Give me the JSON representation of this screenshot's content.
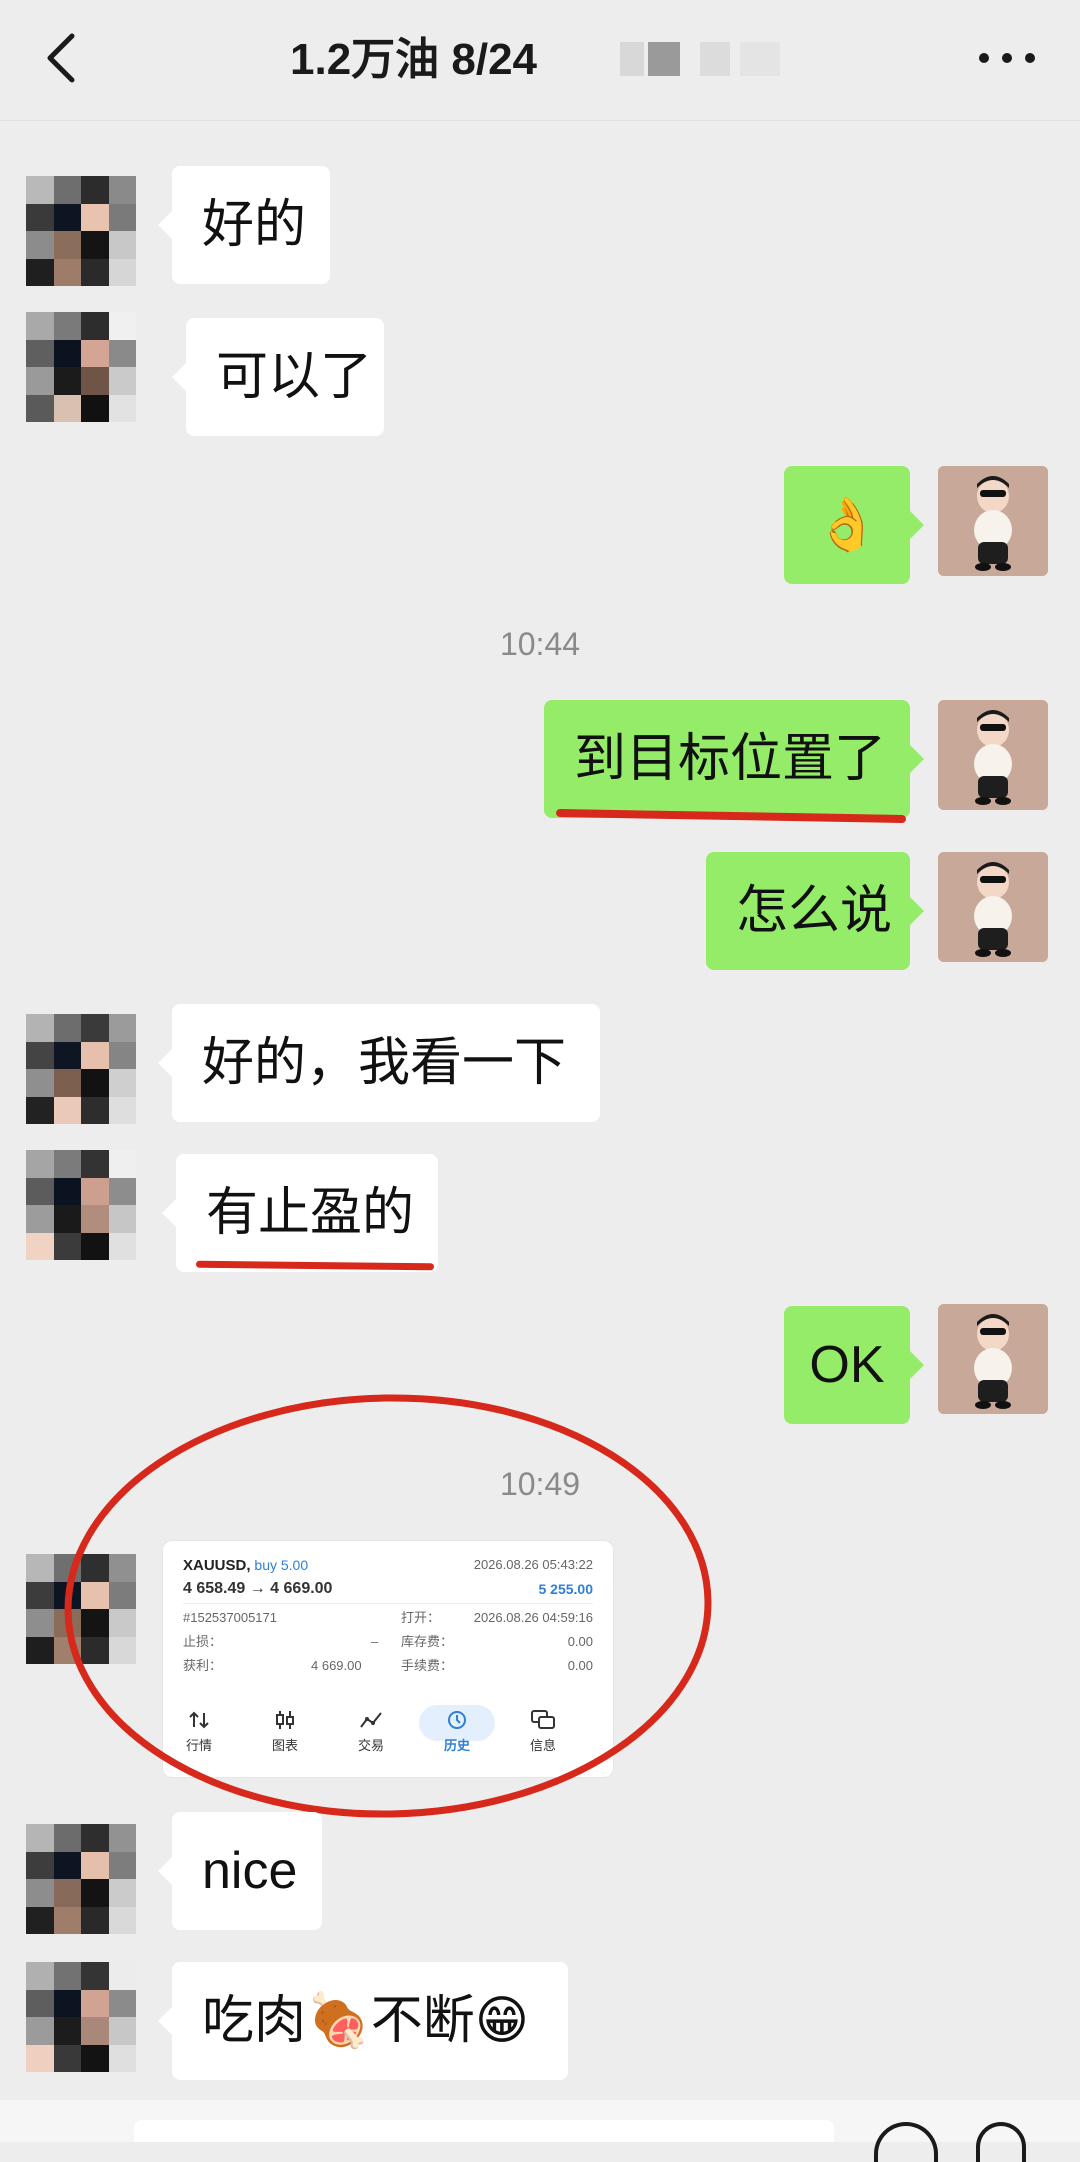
{
  "header": {
    "title": "1.2万油  8/24",
    "back_icon": "chevron-left-icon",
    "more_icon": "more-horizontal-icon"
  },
  "messages": {
    "m1": "好的",
    "m2": "可以了",
    "m3": "👌",
    "time1": "10:44",
    "m4": "到目标位置了",
    "m5": "怎么说",
    "m6": "好的，我看一下",
    "m7": "有止盈的",
    "m8": "OK",
    "time2": "10:49",
    "m9": "nice",
    "m10": "吃肉🍖不断😁"
  },
  "trade_card": {
    "symbol": "XAUUSD,",
    "side": "buy 5.00",
    "open_time": "2026.08.26 05:43:22",
    "price_change": "4 658.49 → 4 669.00",
    "profit_value": "5 255.00",
    "order_id": "#152537005171",
    "open_label": "打开：",
    "open_value": "2026.08.26 04:59:16",
    "sl_label": "止损：",
    "sl_value": "–",
    "swap_label": "库存费：",
    "swap_value": "0.00",
    "tp_label": "获利：",
    "tp_value": "4 669.00",
    "fee_label": "手续费：",
    "fee_value": "0.00",
    "nav": [
      "行情",
      "图表",
      "交易",
      "历史",
      "信息"
    ]
  },
  "colors": {
    "background": "#ededed",
    "incoming_bubble": "#ffffff",
    "outgoing_bubble": "#95ec69",
    "annotation_red": "#d6291c",
    "link_blue": "#2f7fd6"
  }
}
